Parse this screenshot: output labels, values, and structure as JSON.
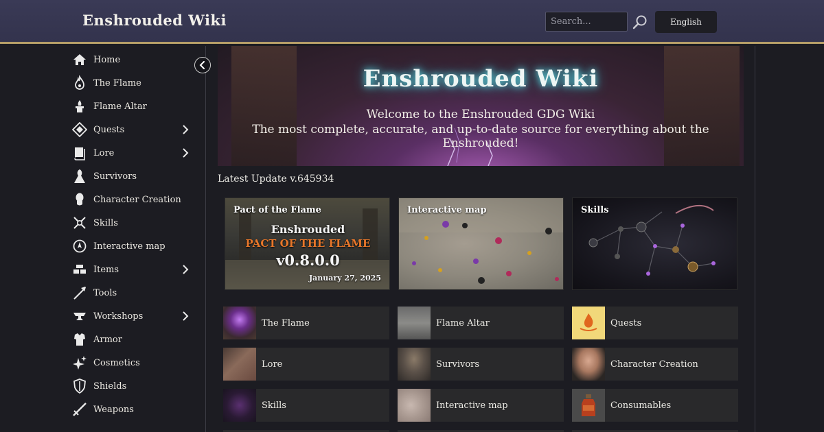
{
  "header": {
    "logo": "Enshrouded Wiki",
    "search_placeholder": "Search...",
    "language": "English"
  },
  "sidebar": {
    "items": [
      {
        "label": "Home",
        "icon": "home-icon",
        "expandable": false
      },
      {
        "label": "The Flame",
        "icon": "flame-icon",
        "expandable": false
      },
      {
        "label": "Flame Altar",
        "icon": "flame-altar-icon",
        "expandable": false
      },
      {
        "label": "Quests",
        "icon": "quests-diamond-icon",
        "expandable": true
      },
      {
        "label": "Lore",
        "icon": "lore-book-icon",
        "expandable": true
      },
      {
        "label": "Survivors",
        "icon": "survivors-icon",
        "expandable": false
      },
      {
        "label": "Character Creation",
        "icon": "character-head-icon",
        "expandable": false
      },
      {
        "label": "Skills",
        "icon": "skills-icon",
        "expandable": false
      },
      {
        "label": "Interactive map",
        "icon": "map-icon",
        "expandable": false
      },
      {
        "label": "Items",
        "icon": "items-icon",
        "expandable": true
      },
      {
        "label": "Tools",
        "icon": "tools-icon",
        "expandable": false
      },
      {
        "label": "Workshops",
        "icon": "anvil-icon",
        "expandable": true
      },
      {
        "label": "Armor",
        "icon": "armor-icon",
        "expandable": false
      },
      {
        "label": "Cosmetics",
        "icon": "sparkle-icon",
        "expandable": false
      },
      {
        "label": "Shields",
        "icon": "shield-icon",
        "expandable": false
      },
      {
        "label": "Weapons",
        "icon": "sword-icon",
        "expandable": false
      }
    ]
  },
  "hero": {
    "logo": "Enshrouded Wiki",
    "line1": "Welcome to the Enshrouded GDG Wiki",
    "line2": "The most complete, accurate, and up-to-date source for everything about the Enshrouded!"
  },
  "update": "Latest Update v.645934",
  "features": [
    {
      "title": "Pact of the Flame",
      "brand": "Enshrouded",
      "subtitle": "PACT OF THE FLAME",
      "version": "v0.8.0.0",
      "date": "January 27, 2025"
    },
    {
      "title": "Interactive map"
    },
    {
      "title": "Skills"
    }
  ],
  "tiles": [
    {
      "label": "The Flame",
      "thumb": "flame-cauldron"
    },
    {
      "label": "Flame Altar",
      "thumb": "stone-altar"
    },
    {
      "label": "Quests",
      "thumb": "quest-flame-emblem"
    },
    {
      "label": "Lore",
      "thumb": "open-book"
    },
    {
      "label": "Survivors",
      "thumb": "survivor-portrait"
    },
    {
      "label": "Character Creation",
      "thumb": "character-portrait"
    },
    {
      "label": "Skills",
      "thumb": "skill-orbs"
    },
    {
      "label": "Interactive map",
      "thumb": "map-texture"
    },
    {
      "label": "Consumables",
      "thumb": "potion-jar"
    }
  ],
  "colors": {
    "header_bg": "#35354f",
    "header_border": "#b79f68",
    "page_bg": "#1c1c22",
    "tile_bg": "#29292b",
    "accent_orange": "#e8772a",
    "glow_teal": "#5fd4dc"
  }
}
